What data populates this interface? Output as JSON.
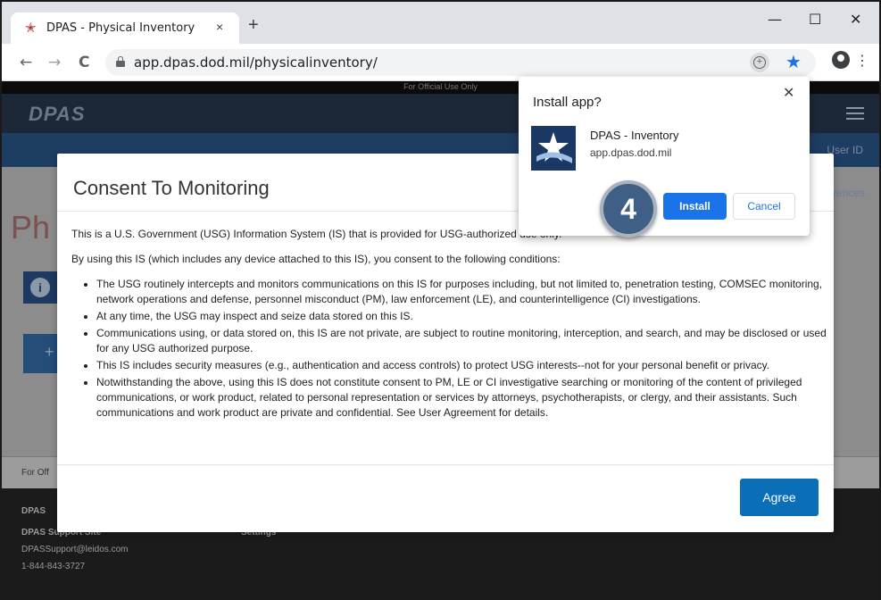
{
  "browser": {
    "tab_title": "DPAS - Physical Inventory",
    "tab_close": "×",
    "new_tab": "+",
    "url": "app.dpas.dod.mil/physicalinventory/",
    "window_controls": {
      "minimize": "—",
      "maximize": "☐",
      "close": "✕"
    },
    "nav": {
      "back": "←",
      "forward": "→",
      "reload": "C"
    },
    "menu_glyph": "⋮",
    "install_glyph": "+",
    "star_glyph": "★"
  },
  "page": {
    "official_use": "For Official Use Only",
    "logo": "DPAS",
    "user_id": "User ID",
    "preferences_fragment": "rences",
    "title_fragment": "Ph",
    "info_glyph": "i",
    "add_glyph": "+",
    "footer_official": "For Off",
    "footer": {
      "heading_fragment": "DPAS",
      "support_site": "DPAS Support Site",
      "settings": "Settings",
      "email": "DPASSupport@leidos.com",
      "phone": "1-844-843-3727"
    }
  },
  "modal": {
    "title": "Consent To Monitoring",
    "intro": "This is a U.S. Government (USG) Information System (IS) that is provided for USG-authorized use only.",
    "conditions_intro": "By using this IS (which includes any device attached to this IS), you consent to the following conditions:",
    "conditions": [
      "The USG routinely intercepts and monitors communications on this IS for purposes including, but not limited to, penetration testing, COMSEC monitoring, network operations and defense, personnel misconduct (PM), law enforcement (LE), and counterintelligence (CI) investigations.",
      "At any time, the USG may inspect and seize data stored on this IS.",
      "Communications using, or data stored on, this IS are not private, are subject to routine monitoring, interception, and search, and may be disclosed or used for any USG authorized purpose.",
      "This IS includes security measures (e.g., authentication and access controls) to protect USG interests--not for your personal benefit or privacy.",
      "Notwithstanding the above, using this IS does not constitute consent to PM, LE or CI investigative searching or monitoring of the content of privileged communications, or work product, related to personal representation or services by attorneys, psychotherapists, or clergy, and their assistants. Such communications and work product are private and confidential. See User Agreement for details."
    ],
    "agree_label": "Agree"
  },
  "install_popup": {
    "title": "Install app?",
    "close": "✕",
    "app_name": "DPAS - Inventory",
    "app_url": "app.dpas.dod.mil",
    "install_label": "Install",
    "cancel_label": "Cancel"
  },
  "step_badge": "4",
  "colors": {
    "primary_blue": "#1a73e8",
    "agree_blue": "#0b6fb8",
    "badge": "#3f5f86",
    "dpas_navy": "#1b3763"
  }
}
